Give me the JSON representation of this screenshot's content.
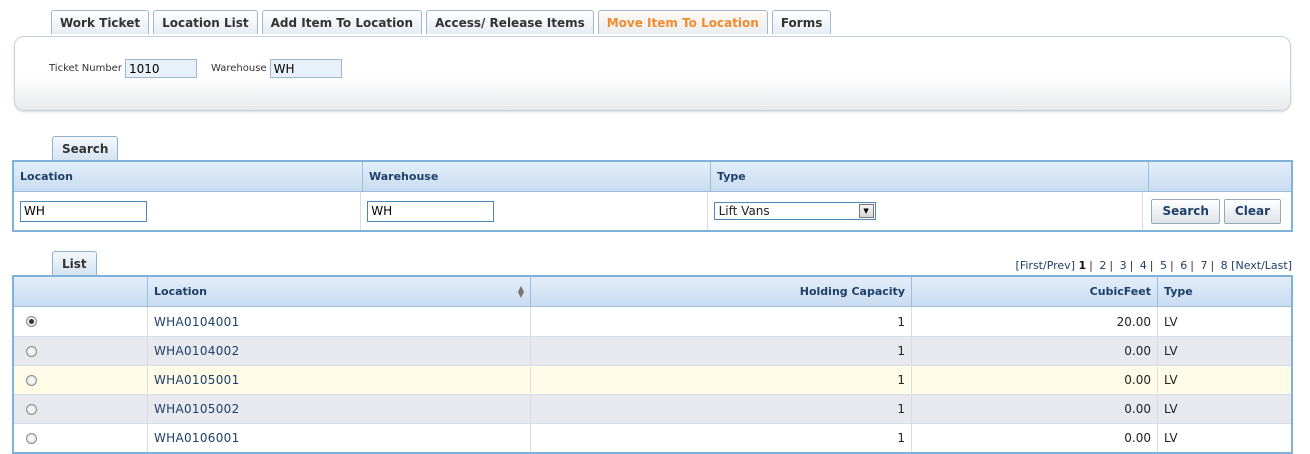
{
  "top_tabs": [
    {
      "label": "Work Ticket"
    },
    {
      "label": "Location List"
    },
    {
      "label": "Add Item To Location"
    },
    {
      "label": "Access/ Release Items"
    },
    {
      "label": "Move Item To Location"
    },
    {
      "label": "Forms"
    }
  ],
  "active_tab_color": "#f08c2e",
  "ticket": {
    "ticket_number_label": "Ticket Number",
    "ticket_number": "1010",
    "warehouse_label": "Warehouse",
    "warehouse": "WH"
  },
  "search": {
    "tab_label": "Search",
    "headers": {
      "location": "Location",
      "warehouse": "Warehouse",
      "type": "Type"
    },
    "location_value": "WH",
    "warehouse_value": "WH",
    "type_value": "Lift Vans",
    "search_button": "Search",
    "clear_button": "Clear"
  },
  "list": {
    "tab_label": "List",
    "pager": {
      "first_prev": "[First/Prev]",
      "pages": [
        "1",
        "2",
        "3",
        "4",
        "5",
        "6",
        "7",
        "8"
      ],
      "current": "1",
      "next_last": "[Next/Last]"
    },
    "headers": {
      "location": "Location",
      "holding_capacity": "Holding Capacity",
      "cubic_feet": "CubicFeet",
      "type": "Type"
    },
    "rows": [
      {
        "location": "WHA0104001",
        "holding_capacity": "1",
        "cubic_feet": "20.00",
        "type": "LV",
        "selected": true
      },
      {
        "location": "WHA0104002",
        "holding_capacity": "1",
        "cubic_feet": "0.00",
        "type": "LV",
        "selected": false
      },
      {
        "location": "WHA0105001",
        "holding_capacity": "1",
        "cubic_feet": "0.00",
        "type": "LV",
        "selected": false
      },
      {
        "location": "WHA0105002",
        "holding_capacity": "1",
        "cubic_feet": "0.00",
        "type": "LV",
        "selected": false
      },
      {
        "location": "WHA0106001",
        "holding_capacity": "1",
        "cubic_feet": "0.00",
        "type": "LV",
        "selected": false
      }
    ]
  }
}
